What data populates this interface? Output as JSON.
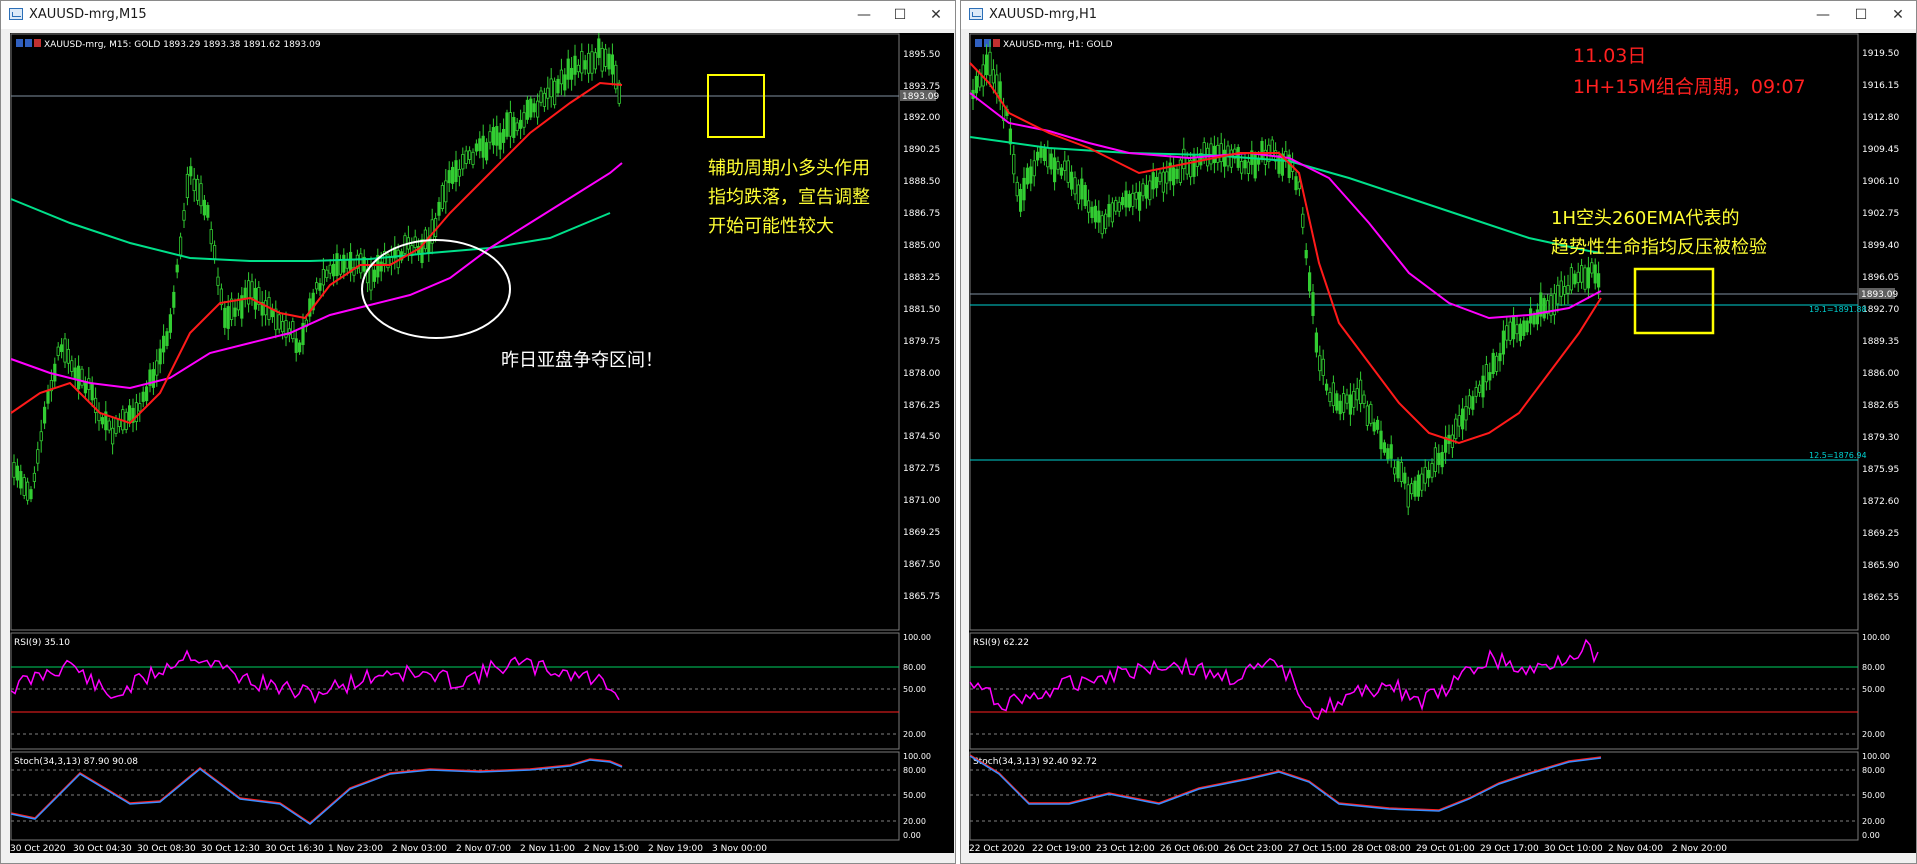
{
  "left_window": {
    "title": "XAUUSD-mrg,M15",
    "chart_info": "XAUUSD-mrg, M15:  GOLD  1893.29 1893.38 1891.62 1893.09",
    "price_ticks": [
      "1895.50",
      "1893.75",
      "1892.00",
      "1890.25",
      "1888.50",
      "1886.75",
      "1885.00",
      "1883.25",
      "1881.50",
      "1879.75",
      "1878.00",
      "1876.25",
      "1874.50",
      "1872.75",
      "1871.00",
      "1869.25",
      "1867.50",
      "1865.75"
    ],
    "current_price": "1893.09",
    "rsi_label": "RSI(9) 35.10",
    "stoch_label": "Stoch(34,3,13) 87.90 90.08",
    "indicator_ticks": [
      "100.00",
      "80.00",
      "50.00",
      "20.00",
      "0.00"
    ],
    "time_ticks": [
      "30 Oct 2020",
      "30 Oct 04:30",
      "30 Oct 08:30",
      "30 Oct 12:30",
      "30 Oct 16:30",
      "1 Nov 23:00",
      "2 Nov 03:00",
      "2 Nov 07:00",
      "2 Nov 11:00",
      "2 Nov 15:00",
      "2 Nov 19:00",
      "3 Nov 00:00"
    ],
    "annotation_1": [
      "辅助周期小多头作用",
      "指均跌落，宣告调整",
      "开始可能性较大"
    ],
    "annotation_2": "昨日亚盘争夺区间！"
  },
  "right_window": {
    "title": "XAUUSD-mrg,H1",
    "chart_info": "XAUUSD-mrg, H1:  GOLD",
    "price_ticks": [
      "1919.50",
      "1916.15",
      "1912.80",
      "1909.45",
      "1906.10",
      "1902.75",
      "1899.40",
      "1896.05",
      "1892.70",
      "1889.35",
      "1886.00",
      "1882.65",
      "1879.30",
      "1875.95",
      "1872.60",
      "1869.25",
      "1865.90",
      "1862.55"
    ],
    "current_price": "1893.09",
    "fib_191": "19.1=1891.88",
    "fib_125": "12.5=1876.94",
    "rsi_label": "RSI(9) 62.22",
    "stoch_label": "Stoch(34,3,13) 92.40 92.72",
    "indicator_ticks": [
      "100.00",
      "80.00",
      "50.00",
      "20.00",
      "0.00"
    ],
    "time_ticks": [
      "22 Oct 2020",
      "22 Oct 19:00",
      "23 Oct 12:00",
      "26 Oct 06:00",
      "26 Oct 23:00",
      "27 Oct 15:00",
      "28 Oct 08:00",
      "29 Oct 01:00",
      "29 Oct 17:00",
      "30 Oct 10:00",
      "2 Nov 04:00",
      "2 Nov 20:00"
    ],
    "date_note": "11.03日",
    "period_note": "1H+15M组合周期，09:07",
    "annotation_1": [
      "1H空头260EMA代表的",
      "趋势性生命指均反压被检验"
    ]
  },
  "window_buttons": {
    "minimize": "—",
    "maximize": "☐",
    "close": "✕"
  },
  "colors": {
    "candle": "#32cd32",
    "ema_red": "#ff1a1a",
    "ema_magenta": "#ff00ff",
    "ema_green": "#00e08a",
    "rsi": "#ff00ff",
    "fib": "#00d0d0",
    "annotation_yellow": "#ffff33",
    "annotation_red": "#ff2020",
    "box": "#ffff00"
  }
}
